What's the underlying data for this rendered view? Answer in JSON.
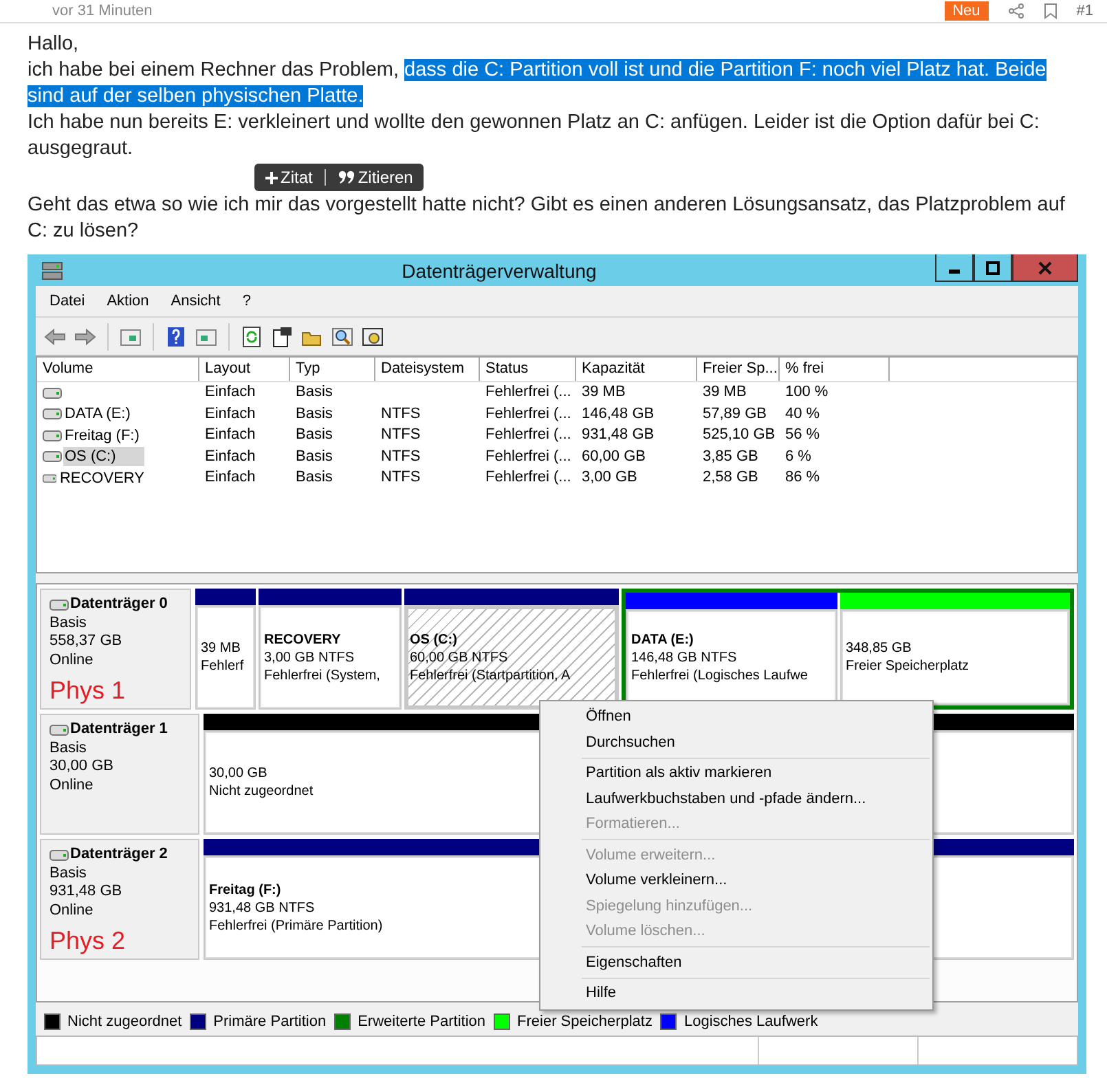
{
  "post": {
    "meta": {
      "time": "vor 31 Minuten",
      "badge": "Neu",
      "number": "#1"
    },
    "paragraphs": [
      [
        {
          "text": "Hallo,",
          "selected": false
        }
      ],
      [
        {
          "text": "ich habe bei einem Rechner das Problem, ",
          "selected": false
        },
        {
          "text": "dass die C: Partition voll ist und die Partition F: noch viel Platz hat. Beide sind auf der selben physischen Platte.",
          "selected": true
        }
      ],
      [
        {
          "text": "Ich habe nun bereits E: verkleinert und wollte den gewonnen Platz an C: anfügen. Leider ist die Option dafür bei C: ausgegraut.",
          "selected": false
        }
      ],
      [
        {
          "text": "Geht das etwa so wie ich mir das vorgestellt hatte nicht? Gibt es einen anderen Lösungsansatz, das Platzproblem auf C: zu lösen?",
          "selected": false
        }
      ]
    ],
    "quote_popup": [
      {
        "kind": "plus",
        "label": "Zitat"
      },
      {
        "kind": "quote",
        "label": "Zitieren"
      }
    ]
  },
  "window": {
    "title": "Datenträgerverwaltung",
    "menu": [
      "Datei",
      "Aktion",
      "Ansicht",
      "?"
    ],
    "table": {
      "columns": [
        "Volume",
        "Layout",
        "Typ",
        "Dateisystem",
        "Status",
        "Kapazität",
        "Freier Sp...",
        "% frei"
      ],
      "rows": [
        {
          "selected": false,
          "cells": [
            "",
            "Einfach",
            "Basis",
            "",
            "Fehlerfrei (...",
            "39 MB",
            "39 MB",
            "100 %"
          ]
        },
        {
          "selected": false,
          "cells": [
            "DATA (E:)",
            "Einfach",
            "Basis",
            "NTFS",
            "Fehlerfrei (...",
            "146,48 GB",
            "57,89 GB",
            "40 %"
          ]
        },
        {
          "selected": false,
          "cells": [
            "Freitag (F:)",
            "Einfach",
            "Basis",
            "NTFS",
            "Fehlerfrei (...",
            "931,48 GB",
            "525,10 GB",
            "56 %"
          ]
        },
        {
          "selected": true,
          "cells": [
            "OS (C:)",
            "Einfach",
            "Basis",
            "NTFS",
            "Fehlerfrei (...",
            "60,00 GB",
            "3,85 GB",
            "6 %"
          ]
        },
        {
          "selected": false,
          "cells": [
            "RECOVERY",
            "Einfach",
            "Basis",
            "NTFS",
            "Fehlerfrei (...",
            "3,00 GB",
            "2,58 GB",
            "86 %"
          ]
        }
      ]
    },
    "disks": [
      {
        "name": "Datenträger 0",
        "type": "Basis",
        "size": "558,37 GB",
        "status": "Online",
        "note": "Phys 1",
        "partitions": [
          {
            "kind": "primary",
            "selected": false,
            "lines": [
              "39 MB",
              "Fehlerf"
            ]
          },
          {
            "kind": "primary",
            "selected": false,
            "name": "RECOVERY",
            "lines": [
              "3,00 GB NTFS",
              "Fehlerfrei (System,"
            ]
          },
          {
            "kind": "primary",
            "selected": true,
            "name": "OS  (C:)",
            "lines": [
              "60,00 GB NTFS",
              "Fehlerfrei (Startpartition, A"
            ]
          },
          {
            "kind": "extended",
            "children": [
              {
                "kind": "logical",
                "selected": false,
                "name": "DATA  (E:)",
                "lines": [
                  "146,48 GB NTFS",
                  "Fehlerfrei (Logisches Laufwe"
                ]
              },
              {
                "kind": "free",
                "selected": false,
                "lines": [
                  "348,85 GB",
                  "Freier Speicherplatz"
                ]
              }
            ]
          }
        ]
      },
      {
        "name": "Datenträger 1",
        "type": "Basis",
        "size": "30,00 GB",
        "status": "Online",
        "partitions": [
          {
            "kind": "unallocated",
            "selected": false,
            "lines": [
              "30,00 GB",
              "Nicht zugeordnet"
            ]
          }
        ]
      },
      {
        "name": "Datenträger 2",
        "type": "Basis",
        "size": "931,48 GB",
        "status": "Online",
        "note": "Phys 2",
        "partitions": [
          {
            "kind": "primary",
            "selected": false,
            "name": "Freitag  (F:)",
            "lines": [
              "931,48 GB NTFS",
              "Fehlerfrei (Primäre Partition)"
            ]
          }
        ]
      }
    ],
    "legend": [
      {
        "label": "Nicht zugeordnet",
        "color": "#000000"
      },
      {
        "label": "Primäre Partition",
        "color": "#000080"
      },
      {
        "label": "Erweiterte Partition",
        "color": "#008000"
      },
      {
        "label": "Freier Speicherplatz",
        "color": "#00ff00"
      },
      {
        "label": "Logisches Laufwerk",
        "color": "#0000ff"
      }
    ],
    "context_menu": [
      {
        "kind": "item",
        "label": "Öffnen",
        "disabled": false
      },
      {
        "kind": "item",
        "label": "Durchsuchen",
        "disabled": false
      },
      {
        "kind": "separator"
      },
      {
        "kind": "item",
        "label": "Partition als aktiv markieren",
        "disabled": false
      },
      {
        "kind": "item",
        "label": "Laufwerkbuchstaben und -pfade ändern...",
        "disabled": false
      },
      {
        "kind": "item",
        "label": "Formatieren...",
        "disabled": true
      },
      {
        "kind": "separator"
      },
      {
        "kind": "item",
        "label": "Volume erweitern...",
        "disabled": true
      },
      {
        "kind": "item",
        "label": "Volume verkleinern...",
        "disabled": false
      },
      {
        "kind": "item",
        "label": "Spiegelung hinzufügen...",
        "disabled": true
      },
      {
        "kind": "item",
        "label": "Volume löschen...",
        "disabled": true
      },
      {
        "kind": "separator"
      },
      {
        "kind": "item",
        "label": "Eigenschaften",
        "disabled": false
      },
      {
        "kind": "separator"
      },
      {
        "kind": "item",
        "label": "Hilfe",
        "disabled": false
      }
    ]
  }
}
